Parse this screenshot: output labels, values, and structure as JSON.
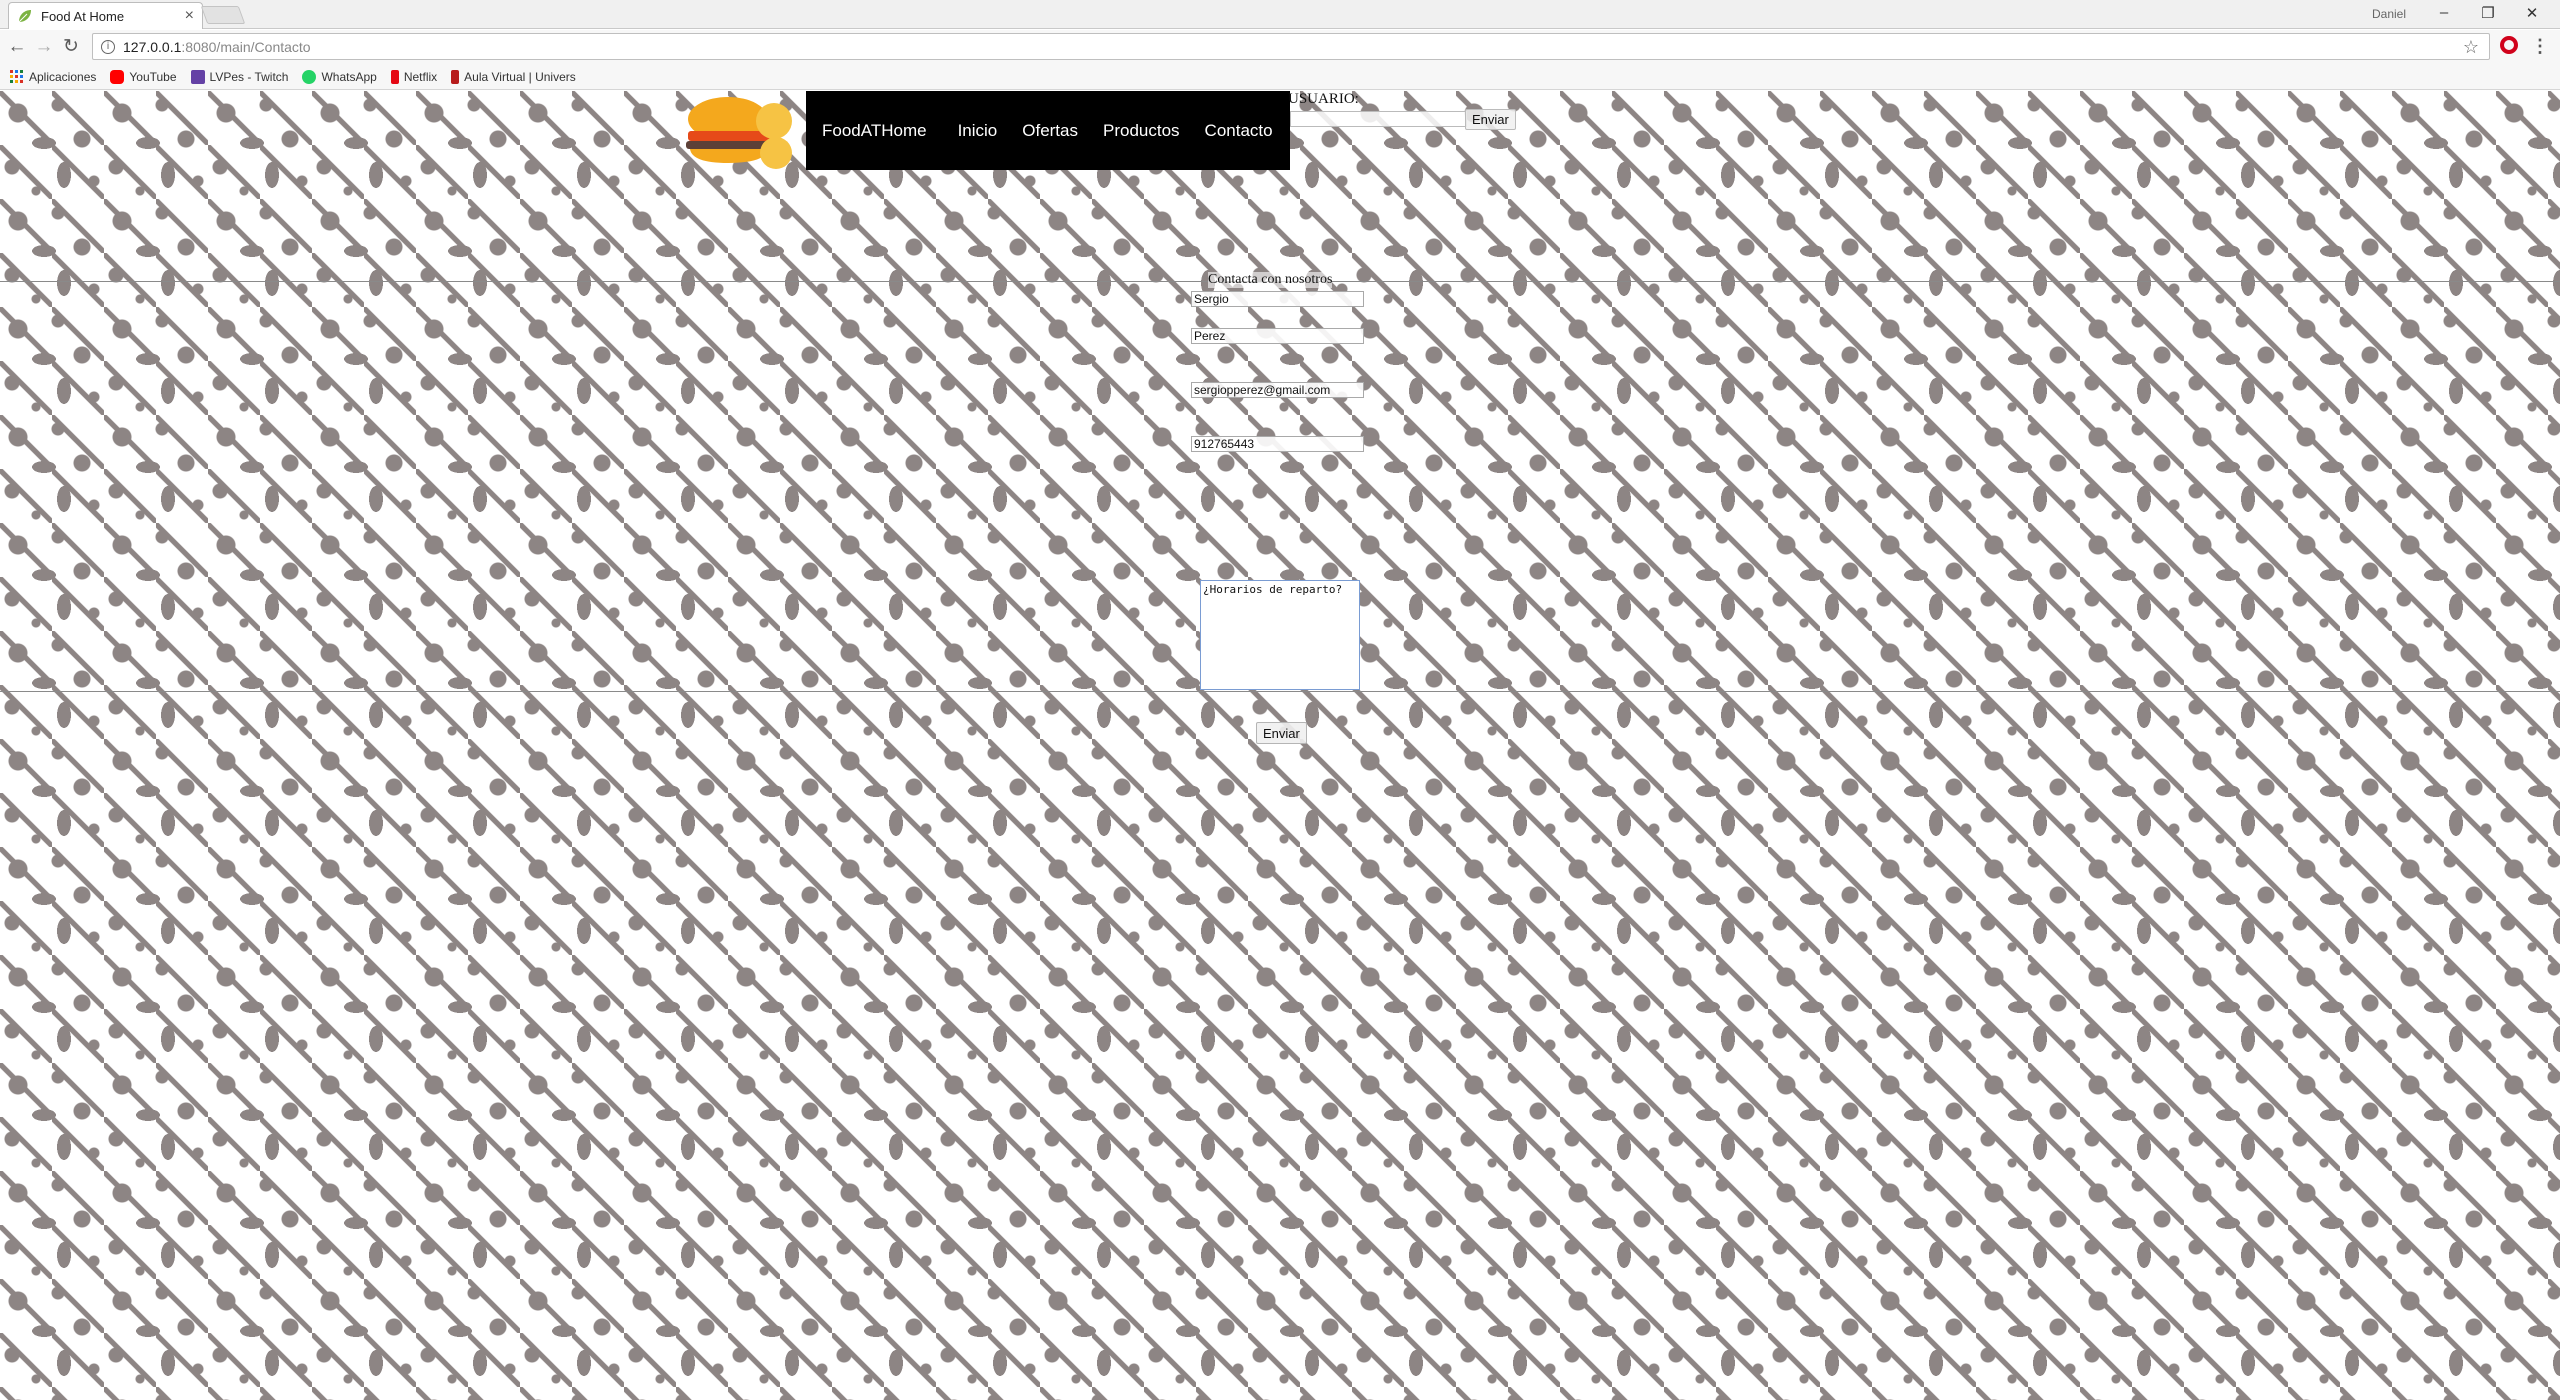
{
  "browser": {
    "tab_title": "Food At Home",
    "profile_name": "Daniel",
    "url_host": "127.0.0.1",
    "url_path": ":8080/main/Contacto",
    "bookmarks": [
      "Aplicaciones",
      "YouTube",
      "LVPes - Twitch",
      "WhatsApp",
      "Netflix",
      "Aula Virtual | Univers"
    ]
  },
  "header": {
    "nav": [
      "FoodATHome",
      "Inicio",
      "Ofertas",
      "Productos",
      "Contacto"
    ],
    "user_label": "USUARIO:",
    "user_submit": "Enviar"
  },
  "contact": {
    "title": "Contacta con nosotros",
    "first_name": "Sergio",
    "last_name": "Perez",
    "email": "sergiopperez@gmail.com",
    "phone": "912765443",
    "message": "¿Horarios de reparto?",
    "submit": "Enviar"
  }
}
